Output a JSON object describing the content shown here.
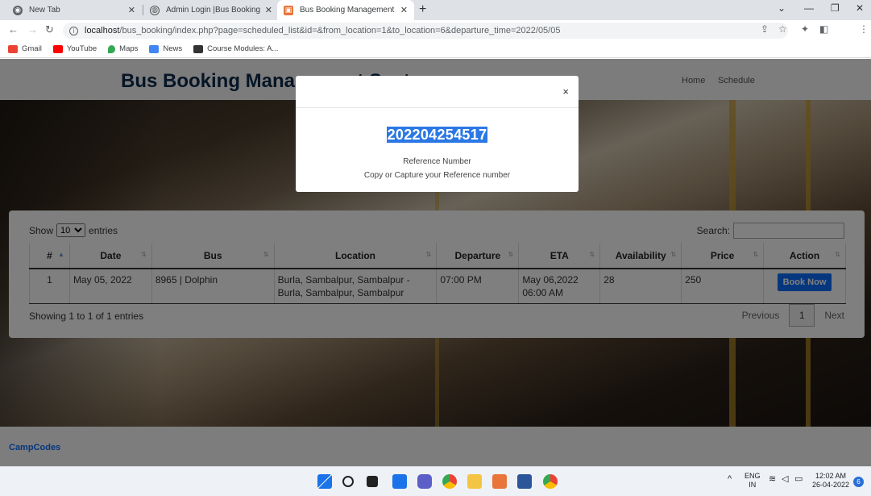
{
  "browser": {
    "tabs": [
      {
        "label": "New Tab",
        "active": false
      },
      {
        "label": "Admin Login |Bus Booking",
        "active": false
      },
      {
        "label": "Bus Booking Management Syste",
        "active": true
      }
    ],
    "url_host": "localhost",
    "url_path": "/bus_booking/index.php?page=scheduled_list&id=&from_location=1&to_location=6&departure_time=2022/05/05",
    "bookmarks": [
      "Gmail",
      "YouTube",
      "Maps",
      "News",
      "Course Modules: A..."
    ]
  },
  "site": {
    "brand": "Bus Booking Management System",
    "nav": [
      "Home",
      "Schedule"
    ],
    "footer_brand": "CampCodes"
  },
  "datatable": {
    "show_label": "Show",
    "entries_value": "10",
    "entries_label": "entries",
    "search_label": "Search:",
    "headers": [
      "#",
      "Date",
      "Bus",
      "Location",
      "Departure",
      "ETA",
      "Availability",
      "Price",
      "Action"
    ],
    "rows": [
      {
        "num": "1",
        "date": "May 05, 2022",
        "bus": "8965 | Dolphin",
        "location_1": "Burla, Sambalpur, Sambalpur -",
        "location_2": "Burla, Sambalpur, Sambalpur",
        "departure": "07:00 PM",
        "eta_1": "May 06,2022",
        "eta_2": "06:00 AM",
        "availability": "28",
        "price": "250",
        "action": "Book Now"
      }
    ],
    "info": "Showing 1 to 1 of 1 entries",
    "prev": "Previous",
    "page": "1",
    "next": "Next"
  },
  "modal": {
    "reference_number": "202204254517",
    "label": "Reference Number",
    "hint": "Copy or Capture your Reference number",
    "close": "×"
  },
  "taskbar": {
    "lang_1": "ENG",
    "lang_2": "IN",
    "time": "12:02 AM",
    "date": "26-04-2022",
    "notifications": "6"
  }
}
